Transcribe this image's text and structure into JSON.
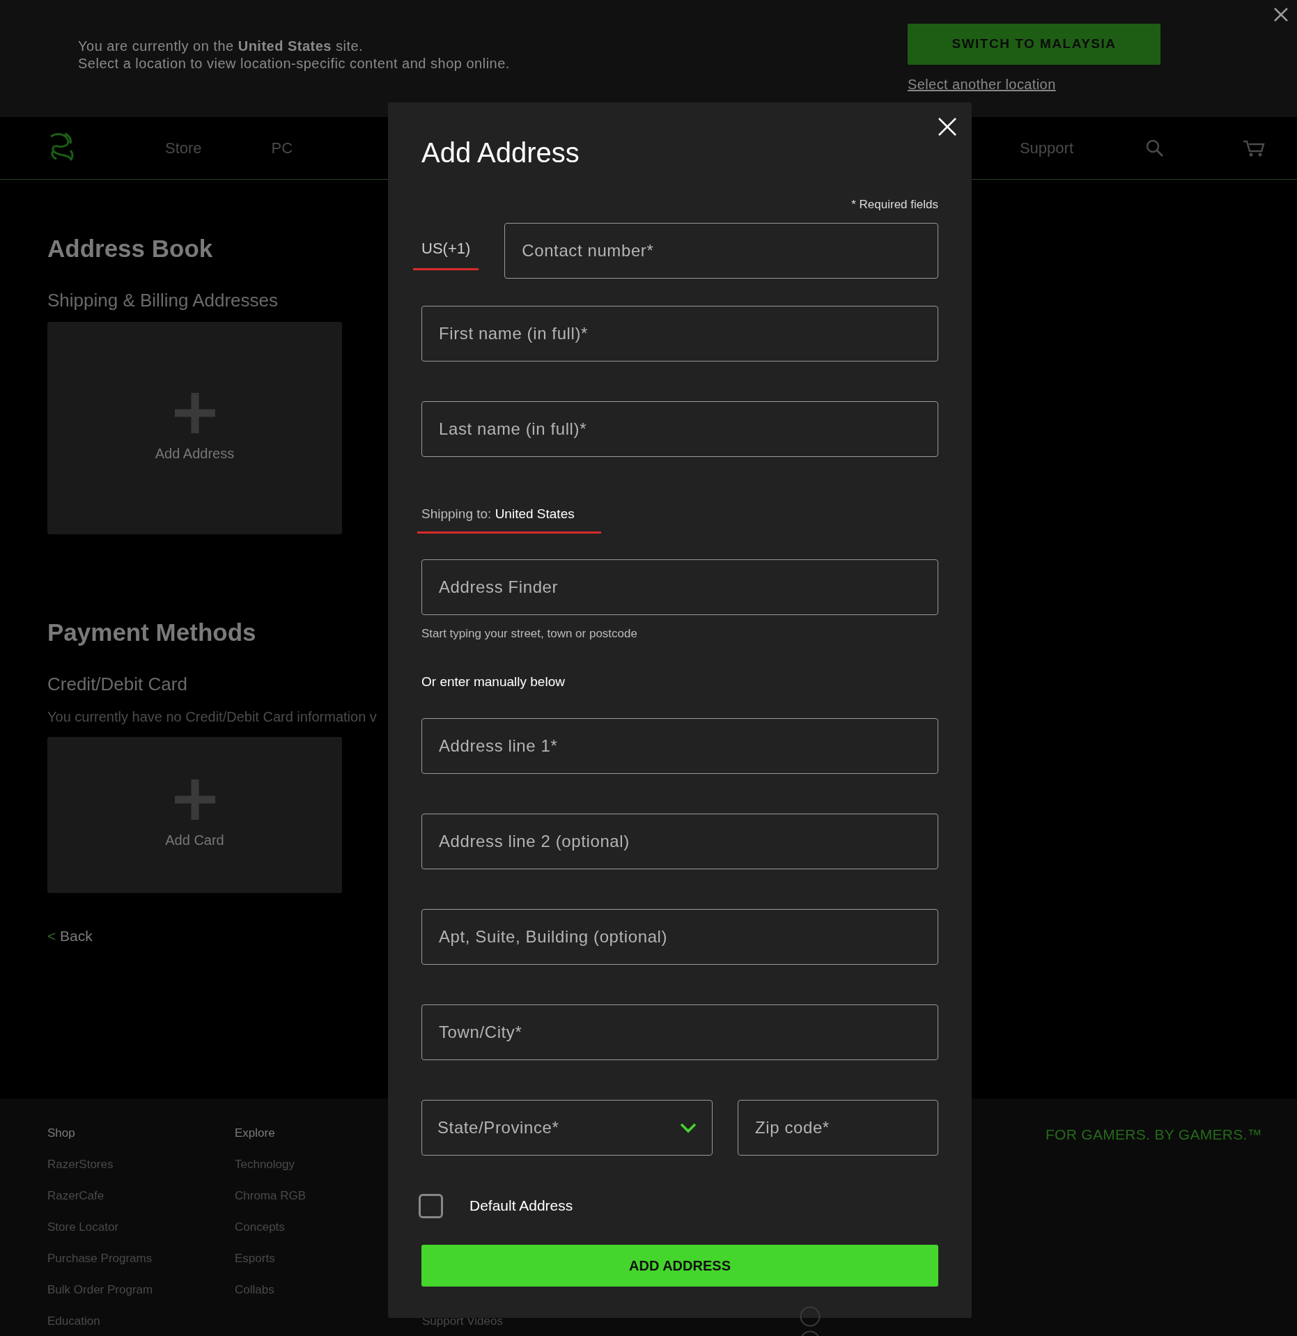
{
  "banner": {
    "message": "You are currently on the **United States** site.",
    "message_2": "Select a location to view location-specific content and shop online.",
    "switch_button": "SWITCH TO MALAYSIA",
    "other_link": "Select another location"
  },
  "nav": {
    "items_left": [
      "Store",
      "PC"
    ],
    "items_right": [
      "Support"
    ]
  },
  "address_book": {
    "title": "Address Book",
    "subtitle": "Shipping & Billing Addresses",
    "add_tile": "Add Address"
  },
  "payment": {
    "title": "Payment Methods",
    "subtitle": "Credit/Debit Card",
    "note": "You currently have no Credit/Debit Card information v",
    "add_tile": "Add Card"
  },
  "back_link": {
    "arrow": "<",
    "label": "Back"
  },
  "footer": {
    "columns": [
      {
        "heading": "Shop",
        "links": [
          "RazerStores",
          "RazerCafe",
          "Store Locator",
          "Purchase Programs",
          "Bulk Order Program",
          "Education"
        ]
      },
      {
        "heading": "Explore",
        "links": [
          "Technology",
          "Chroma RGB",
          "Concepts",
          "Esports",
          "Collabs"
        ]
      }
    ],
    "partial_link": "Support Videos",
    "tagline": "FOR GAMERS. BY GAMERS.™"
  },
  "modal": {
    "title": "Add Address",
    "required_note": "* Required fields",
    "country_code": "US(+1)",
    "phone_field": {
      "placeholder": "Contact number*"
    },
    "name_fields": [
      {
        "placeholder": "First name (in full)*"
      },
      {
        "placeholder": "Last name (in full)*"
      }
    ],
    "shipping_label": "Shipping to:",
    "shipping_country": "United States",
    "finder": {
      "placeholder": "Address Finder",
      "hint": "Start typing your street, town or postcode"
    },
    "manual_note": "Or enter manually below",
    "address_fields": [
      {
        "placeholder": "Address line 1*"
      },
      {
        "placeholder": "Address line 2 (optional)"
      },
      {
        "placeholder": "Apt, Suite, Building (optional)"
      },
      {
        "placeholder": "Town/City*"
      }
    ],
    "state_select": {
      "placeholder": "State/Province*"
    },
    "zip_field": {
      "placeholder": "Zip code*"
    },
    "default_checkbox": {
      "label": "Default Address",
      "checked": false
    },
    "submit": "ADD ADDRESS"
  }
}
